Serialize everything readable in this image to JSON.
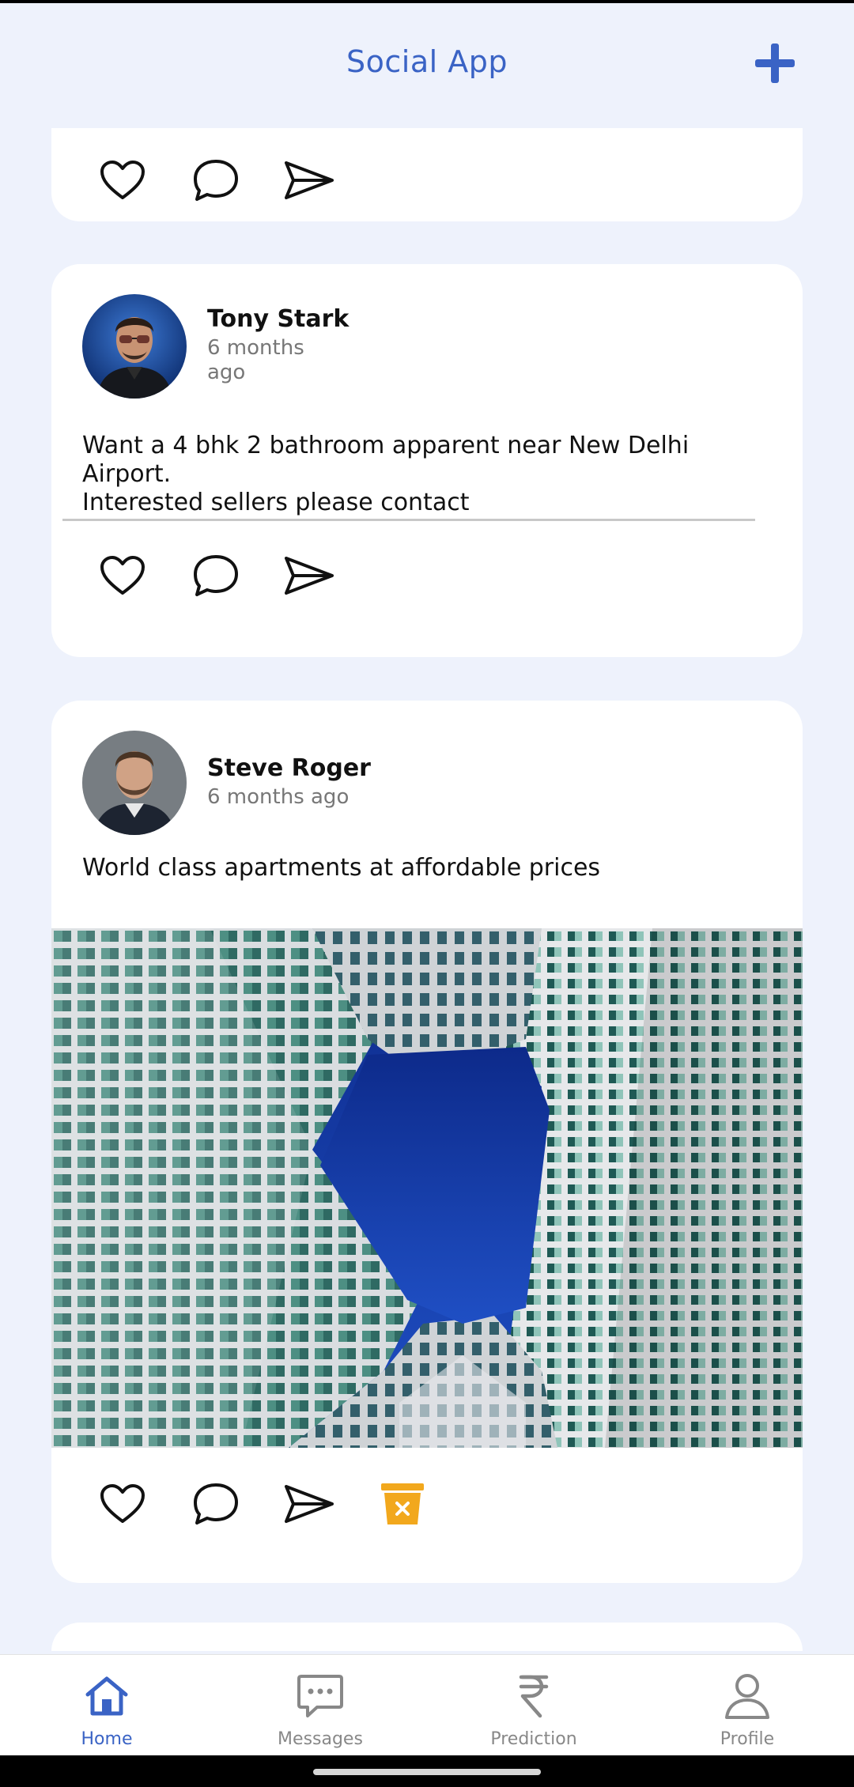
{
  "app": {
    "title": "Social App",
    "accent_color": "#3a63c5"
  },
  "posts": [
    {
      "author": "Tony Stark",
      "time_line1": "6 months",
      "time_line2": "ago",
      "text_line1": "Want a 4 bhk 2 bathroom apparent near New Delhi Airport.",
      "text_line2": "Interested sellers please contact"
    },
    {
      "author": "Steve  Roger",
      "time": "6 months ago",
      "text": "World class apartments at affordable prices"
    }
  ],
  "icons": {
    "like": "heart-icon",
    "comment": "comment-icon",
    "share": "send-icon",
    "delete": "delete-bin-icon",
    "delete_color": "#f2a81d"
  },
  "nav": {
    "items": [
      {
        "label": "Home",
        "icon": "home-icon",
        "active": true
      },
      {
        "label": "Messages",
        "icon": "messages-icon",
        "active": false
      },
      {
        "label": "Prediction",
        "icon": "rupee-icon",
        "active": false
      },
      {
        "label": "Profile",
        "icon": "profile-icon",
        "active": false
      }
    ]
  }
}
